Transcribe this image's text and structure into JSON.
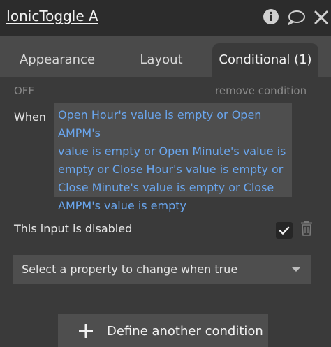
{
  "header": {
    "title": "IonicToggle A",
    "icons": [
      "info-icon",
      "comment-icon",
      "close-icon"
    ]
  },
  "tabs": [
    {
      "label": "Appearance",
      "active": false
    },
    {
      "label": "Layout",
      "active": false
    },
    {
      "label": "Conditional (1)",
      "active": true
    }
  ],
  "condition": {
    "state": "OFF",
    "remove_label": "remove condition",
    "when_label": "When",
    "expression_lines": [
      "Open Hour's value is empty or Open AMPM's",
      "value is empty or Open Minute's value is",
      "empty or Close Hour's value is empty or",
      "Close Minute's value is empty or Close",
      "AMPM's value is empty"
    ],
    "property_label": "This input is disabled",
    "property_checked": true,
    "select_placeholder": "Select a property to change when true"
  },
  "footer": {
    "define_label": "Define another condition"
  },
  "colors": {
    "expression_text": "#6aa6ee",
    "panel_bg": "#3a3a3a",
    "header_bg": "#2c2c2c"
  }
}
